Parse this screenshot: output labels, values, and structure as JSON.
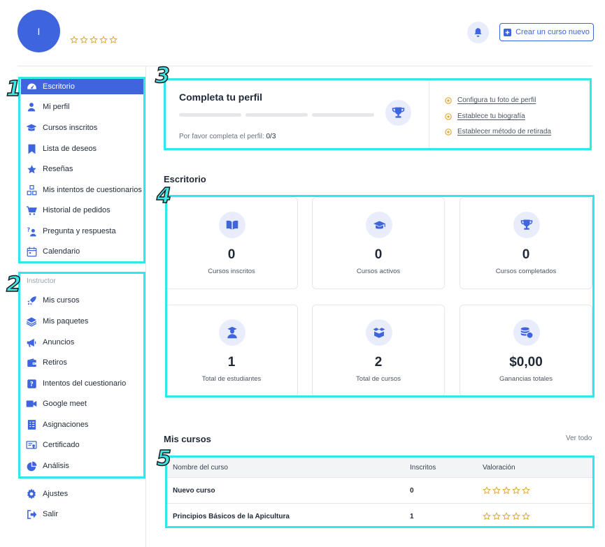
{
  "header": {
    "avatar_initial": "I",
    "rating_stars": 5,
    "create_course_label": "Crear un curso nuevo"
  },
  "sidebar": {
    "main_items": [
      {
        "label": "Escritorio",
        "icon": "dashboard-icon",
        "active": true
      },
      {
        "label": "Mi perfil",
        "icon": "user-icon"
      },
      {
        "label": "Cursos inscritos",
        "icon": "graduation-cap-icon"
      },
      {
        "label": "Lista de deseos",
        "icon": "bookmark-icon"
      },
      {
        "label": "Reseñas",
        "icon": "star-icon"
      },
      {
        "label": "Mis intentos de cuestionarios",
        "icon": "quiz-attempts-icon"
      },
      {
        "label": "Historial de pedidos",
        "icon": "cart-icon"
      },
      {
        "label": "Pregunta y respuesta",
        "icon": "question-answer-icon"
      },
      {
        "label": "Calendario",
        "icon": "calendar-icon"
      }
    ],
    "instructor_label": "Instructor",
    "instructor_items": [
      {
        "label": "Mis cursos",
        "icon": "rocket-icon"
      },
      {
        "label": "Mis paquetes",
        "icon": "layers-icon"
      },
      {
        "label": "Anuncios",
        "icon": "megaphone-icon"
      },
      {
        "label": "Retiros",
        "icon": "wallet-icon"
      },
      {
        "label": "Intentos del cuestionario",
        "icon": "quiz-icon"
      },
      {
        "label": "Google meet",
        "icon": "video-icon"
      },
      {
        "label": "Asignaciones",
        "icon": "assignment-icon"
      },
      {
        "label": "Certificado",
        "icon": "certificate-icon"
      },
      {
        "label": "Análisis",
        "icon": "pie-chart-icon"
      }
    ],
    "footer_items": [
      {
        "label": "Ajustes",
        "icon": "gear-icon"
      },
      {
        "label": "Salir",
        "icon": "logout-icon"
      }
    ]
  },
  "profile_completion": {
    "title": "Completa tu perfil",
    "subtitle": "Por favor completa el perfil:",
    "progress": "0/3",
    "steps_done": 0,
    "steps_total": 3,
    "tasks": [
      "Configura tu foto de perfil",
      "Establece tu biografía",
      "Establecer método de retirada"
    ]
  },
  "dashboard": {
    "title": "Escritorio",
    "stats": [
      {
        "value": "0",
        "label": "Cursos inscritos",
        "icon": "open-book-icon"
      },
      {
        "value": "0",
        "label": "Cursos activos",
        "icon": "graduation-cap-icon"
      },
      {
        "value": "0",
        "label": "Cursos completados",
        "icon": "trophy-icon"
      },
      {
        "value": "1",
        "label": "Total de estudiantes",
        "icon": "student-icon"
      },
      {
        "value": "2",
        "label": "Total de cursos",
        "icon": "boxes-icon"
      },
      {
        "value": "$0,00",
        "label": "Ganancias totales",
        "icon": "coins-icon"
      }
    ]
  },
  "my_courses": {
    "title": "Mis cursos",
    "see_all": "Ver todo",
    "columns": [
      "Nombre del curso",
      "Inscritos",
      "Valoración"
    ],
    "rows": [
      {
        "name": "Nuevo curso",
        "enrolled": "0",
        "rating": 0
      },
      {
        "name": "Principios Básicos de la Apicultura",
        "enrolled": "1",
        "rating": 0
      }
    ]
  },
  "annotations": [
    "1",
    "2",
    "3",
    "4",
    "5"
  ],
  "colors": {
    "primary": "#3e64de",
    "icon_bg": "#e9edfb",
    "highlight": "#2ee8ea",
    "star": "#e2a93b"
  }
}
